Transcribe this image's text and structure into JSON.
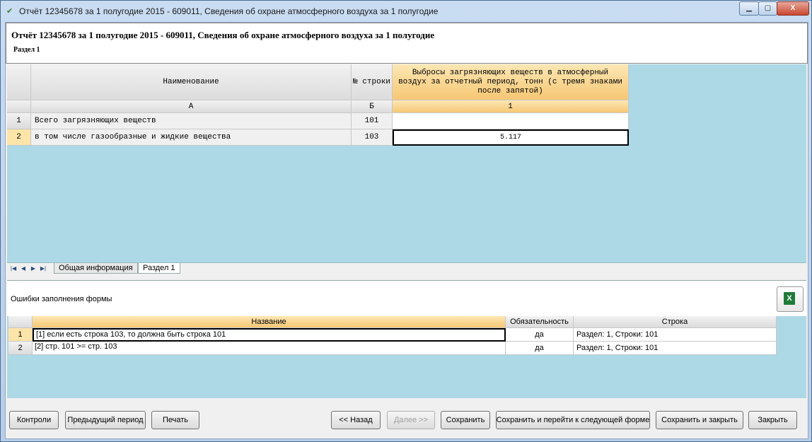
{
  "window": {
    "title": "Отчёт 12345678 за 1 полугодие 2015 - 609011, Сведения об охране атмосферного воздуха за 1 полугодие",
    "min_glyph": "▁",
    "max_glyph": "▢",
    "close_glyph": "X"
  },
  "header": {
    "title": "Отчёт 12345678 за 1 полугодие 2015 - 609011, Сведения об охране атмосферного воздуха за 1 полугодие",
    "section": "Раздел 1"
  },
  "sheet": {
    "col_name": "Наименование",
    "col_rownum": "№ строки",
    "col_value": "Выбросы загрязняющих веществ в атмосферный воздух за отчетный период, тонн (с тремя знаками после запятой)",
    "code_a": "А",
    "code_b": "Б",
    "code_1": "1",
    "rows": [
      {
        "num": "1",
        "name": "Всего загрязняющих веществ",
        "line": "101",
        "value": ""
      },
      {
        "num": "2",
        "name": "в том числе газообразные и жидкие вещества",
        "line": "103",
        "value": "5.117"
      }
    ]
  },
  "tabs": {
    "items": [
      "Общая информация",
      "Раздел 1"
    ],
    "active": "Раздел 1"
  },
  "errors": {
    "label": "Ошибки заполнения формы",
    "col_name": "Название",
    "col_required": "Обязательность",
    "col_row": "Строка",
    "rows": [
      {
        "num": "1",
        "name": "[1] если есть строка 103, то должна быть строка 101",
        "required": "да",
        "row": "Раздел: 1, Строки: 101"
      },
      {
        "num": "2",
        "name": "[2]  стр. 101 >= стр. 103",
        "required": "да",
        "row": "Раздел: 1, Строки: 101"
      }
    ]
  },
  "buttons": {
    "controls": "Контроли",
    "prev_period": "Предыдущий период",
    "print": "Печать",
    "back": "<< Назад",
    "next": "Далее >>",
    "save": "Сохранить",
    "save_next": "Сохранить и перейти к следующей форме",
    "save_close": "Сохранить и закрыть",
    "close": "Закрыть"
  },
  "colors": {
    "grid_background": "#add8e6",
    "header_orange": "#f6c774",
    "row_selected": "#fde4a8"
  }
}
